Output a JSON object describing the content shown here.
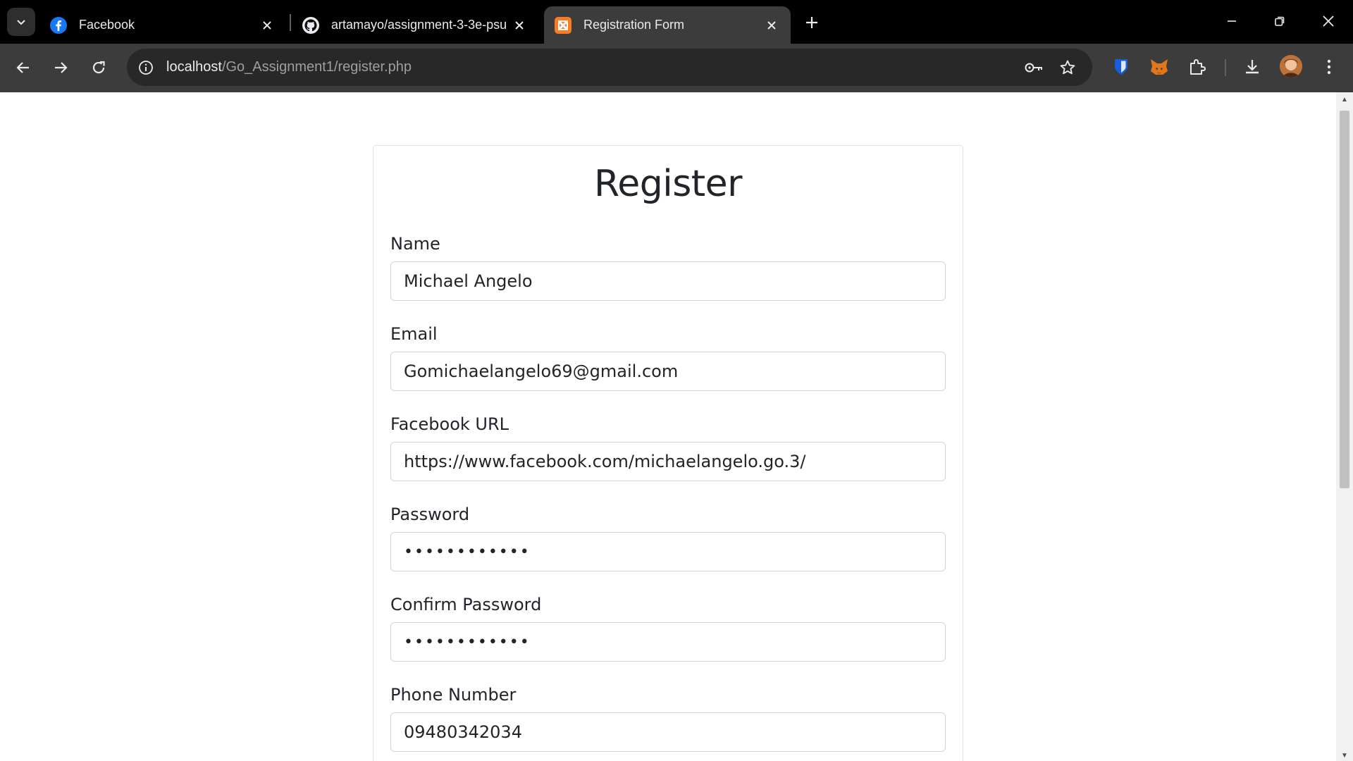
{
  "browser": {
    "tabs": [
      {
        "title": "Facebook",
        "icon": "facebook-icon",
        "active": false
      },
      {
        "title": "artamayo/assignment-3-3e-psu",
        "icon": "github-icon",
        "active": false
      },
      {
        "title": "Registration Form",
        "icon": "xampp-icon",
        "active": true
      }
    ],
    "address": {
      "host": "localhost",
      "path": "/Go_Assignment1/register.php"
    },
    "colors": {
      "tabstrip": "#000000",
      "toolbar": "#3c3c3c",
      "omnibox": "#282828",
      "active_tab": "#3c3c3c"
    }
  },
  "form": {
    "title": "Register",
    "fields": [
      {
        "label": "Name",
        "value": "Michael Angelo"
      },
      {
        "label": "Email",
        "value": "Gomichaelangelo69@gmail.com"
      },
      {
        "label": "Facebook URL",
        "value": "https://www.facebook.com/michaelangelo.go.3/"
      },
      {
        "label": "Password",
        "value": "••••••••••••"
      },
      {
        "label": "Confirm Password",
        "value": "••••••••••••"
      },
      {
        "label": "Phone Number",
        "value": "09480342034"
      }
    ]
  }
}
